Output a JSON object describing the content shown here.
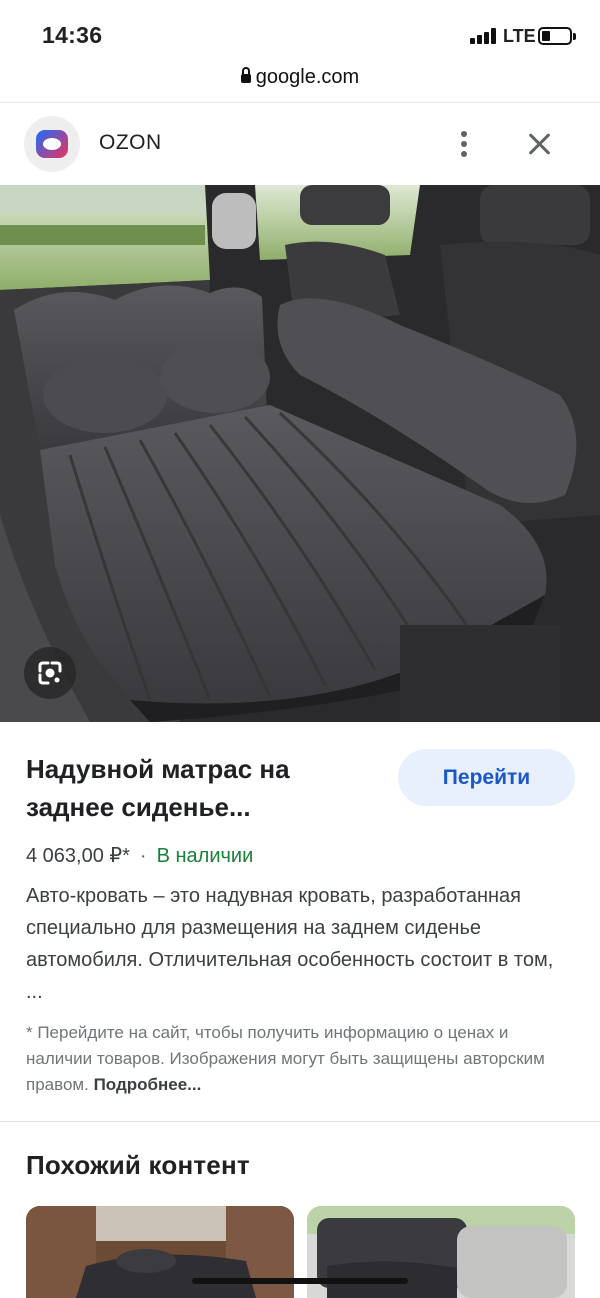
{
  "status_bar": {
    "time": "14:36",
    "network": "LTE",
    "icons": [
      "signal-icon",
      "battery-icon"
    ]
  },
  "browser": {
    "url": "google.com",
    "icon": "lock-icon"
  },
  "site": {
    "name": "OZON",
    "icons": [
      "ozon-logo",
      "more-vert-icon",
      "close-icon"
    ]
  },
  "product": {
    "title": "Надувной матрас на заднее сиденье...",
    "go_button_label": "Перейти",
    "price": "4 063,00 ₽*",
    "separator": "·",
    "availability": "В наличии",
    "description": "Авто-кровать – это надувная кровать, разработанная специально для размещения на заднем сиденье автомобиля. Отличительная особенность состоит в том, ...",
    "disclaimer": "* Перейдите на сайт, чтобы получить информацию о ценах и наличии товаров. Изображения могут быть защищены авторским правом.",
    "more_link": "Подробнее..."
  },
  "similar": {
    "title": "Похожий контент"
  },
  "colors": {
    "accent_blue": "#1a57c9",
    "button_bg": "#e8f0fe",
    "availability_green": "#188038",
    "text_primary": "#202124",
    "text_secondary": "#3c4043",
    "text_muted": "#70757a"
  }
}
